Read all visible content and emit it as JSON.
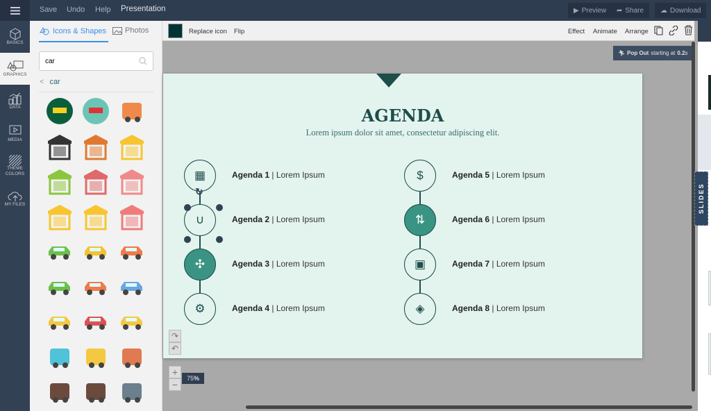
{
  "topbar": {
    "menu": [
      "Save",
      "Undo",
      "Help"
    ],
    "title": "Presentation",
    "preview": "Preview",
    "share": "Share",
    "download": "Download"
  },
  "rail": [
    {
      "label": "BASICS",
      "icon": "cube-icon"
    },
    {
      "label": "GRAPHICS",
      "icon": "shapes-icon",
      "active": true
    },
    {
      "label": "DATA",
      "icon": "chart-icon"
    },
    {
      "label": "MEDIA",
      "icon": "media-icon"
    },
    {
      "label": "THEME COLORS",
      "icon": "stripes-icon"
    },
    {
      "label": "MY FILES",
      "icon": "cloud-upload-icon"
    }
  ],
  "panel": {
    "tab_icons": "Icons & Shapes",
    "tab_photos": "Photos",
    "search_value": "car",
    "back_label": "car",
    "icons": [
      "taxi-sign",
      "bumper-car",
      "bank-truck",
      "gas-station-dark",
      "garage-orange",
      "gas-station-yellow",
      "garage-green",
      "garage-house",
      "garage-pink",
      "garage-yellow",
      "house-yellow",
      "garage-red",
      "car-green",
      "tractor-yellow",
      "car-orange",
      "car-green-front",
      "car-orange-2",
      "bus-blue",
      "taxi-yellow",
      "taxi-red",
      "car-yellow",
      "sports-car",
      "taxi-front",
      "road-curve",
      "car-crash",
      "parking",
      "mechanic"
    ]
  },
  "toolbar": {
    "color": "#023436",
    "replace": "Replace icon",
    "flip": "Flip",
    "effect": "Effect",
    "animate": "Animate",
    "arrange": "Arrange"
  },
  "animation_badge": {
    "effect": "Pop Out",
    "middle": "starting at",
    "time": "0.2",
    "unit": "s"
  },
  "slide": {
    "title": "AGENDA",
    "subtitle": "Lorem ipsum dolor sit amet, consectetur adipiscing elit.",
    "items": [
      {
        "name": "Agenda 1",
        "desc": "Lorem Ipsum",
        "icon": "cube-grid-icon"
      },
      {
        "name": "Agenda 2",
        "desc": "Lorem Ipsum",
        "icon": "magnet-icon"
      },
      {
        "name": "Agenda 3",
        "desc": "Lorem Ipsum",
        "icon": "puzzle-icon",
        "filled": true
      },
      {
        "name": "Agenda 4",
        "desc": "Lorem Ipsum",
        "icon": "gears-icon"
      },
      {
        "name": "Agenda 5",
        "desc": "Lorem Ipsum",
        "icon": "dollar-chart-icon"
      },
      {
        "name": "Agenda 6",
        "desc": "Lorem Ipsum",
        "icon": "direction-arrows-icon",
        "filled": true
      },
      {
        "name": "Agenda 7",
        "desc": "Lorem Ipsum",
        "icon": "briefcase-icon"
      },
      {
        "name": "Agenda 8",
        "desc": "Lorem Ipsum",
        "icon": "handshake-icon"
      }
    ]
  },
  "zoom": {
    "value": "75",
    "unit": "%"
  },
  "slides_tab": "SLIDES",
  "colors": {
    "accent": "#3a9484",
    "dark": "#2f3d50",
    "title": "#1f4d4a",
    "slide_bg": "#e3f4ef",
    "tab_blue": "#3b8ee8"
  }
}
